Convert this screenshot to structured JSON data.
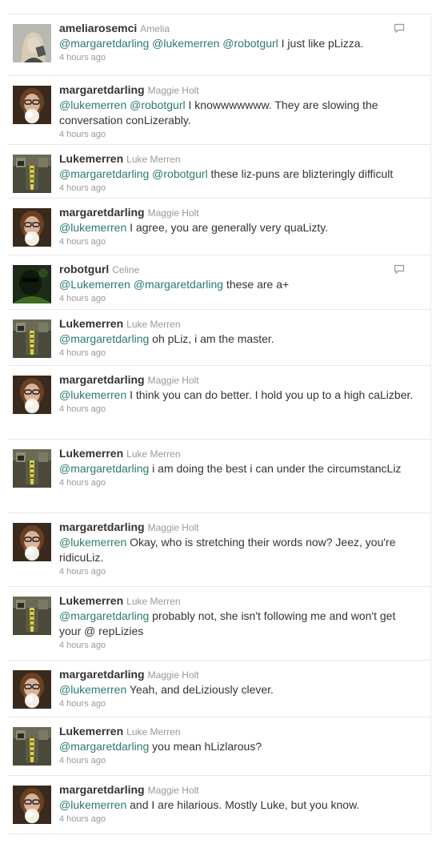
{
  "tweets": [
    {
      "avatar": "blonde-woman",
      "username": "ameliarosemci",
      "realname": "Amelia",
      "mentions": [
        "@margaretdarling",
        "@lukemerren",
        "@robotgurl"
      ],
      "text": " I just like pLizza.",
      "time": "4 hours ago",
      "reply_icon": true
    },
    {
      "avatar": "bearded-man",
      "username": "margaretdarling",
      "realname": "Maggie Holt",
      "mentions": [
        "@lukemerren",
        "@robotgurl"
      ],
      "text": " I knowwwwwww. They are slowing the conversation conLizerably.",
      "time": "4 hours ago",
      "reply_icon": false
    },
    {
      "avatar": "robot-tie",
      "username": "Lukemerren",
      "realname": "Luke Merren",
      "mentions": [
        "@margaretdarling",
        "@robotgurl"
      ],
      "text": " these liz-puns are blizteringly difficult",
      "time": "4 hours ago",
      "reply_icon": false
    },
    {
      "avatar": "bearded-man",
      "username": "margaretdarling",
      "realname": "Maggie Holt",
      "mentions": [
        "@lukemerren"
      ],
      "text": " I agree, you are generally very quaLizty.",
      "time": "4 hours ago",
      "reply_icon": false
    },
    {
      "avatar": "dark-green",
      "username": "robotgurl",
      "realname": "Celine",
      "mentions": [
        "@Lukemerren",
        "@margaretdarling"
      ],
      "text": " these are a+",
      "time": "4 hours ago",
      "reply_icon": true
    },
    {
      "avatar": "robot-tie",
      "username": "Lukemerren",
      "realname": "Luke Merren",
      "mentions": [
        "@margaretdarling"
      ],
      "text": " oh pLiz, i am the master.",
      "time": "4 hours ago",
      "reply_icon": false
    },
    {
      "avatar": "bearded-man",
      "username": "margaretdarling",
      "realname": "Maggie Holt",
      "mentions": [
        "@lukemerren"
      ],
      "text": " I think you can do better. I hold you up to a high caLizber.",
      "time": "4 hours ago",
      "reply_icon": false
    },
    {
      "avatar": "robot-tie",
      "username": "Lukemerren",
      "realname": "Luke Merren",
      "mentions": [
        "@margaretdarling"
      ],
      "text": " i am doing the best i can under the circumstancLiz",
      "time": "4 hours ago",
      "reply_icon": false
    },
    {
      "avatar": "bearded-man",
      "username": "margaretdarling",
      "realname": "Maggie Holt",
      "mentions": [
        "@lukemerren"
      ],
      "text": " Okay, who is stretching their words now? Jeez, you're ridicuLiz.",
      "time": "4 hours ago",
      "reply_icon": false
    },
    {
      "avatar": "robot-tie",
      "username": "Lukemerren",
      "realname": "Luke Merren",
      "mentions": [
        "@margaretdarling"
      ],
      "text": " probably not, she isn't following me and won't get your @ repLizies",
      "time": "4 hours ago",
      "reply_icon": false
    },
    {
      "avatar": "bearded-man",
      "username": "margaretdarling",
      "realname": "Maggie Holt",
      "mentions": [
        "@lukemerren"
      ],
      "text": " Yeah, and deLiziously clever.",
      "time": "4 hours ago",
      "reply_icon": false
    },
    {
      "avatar": "robot-tie",
      "username": "Lukemerren",
      "realname": "Luke Merren",
      "mentions": [
        "@margaretdarling"
      ],
      "text": " you mean hLizlarous?",
      "time": "4 hours ago",
      "reply_icon": false
    },
    {
      "avatar": "bearded-man",
      "username": "margaretdarling",
      "realname": "Maggie Holt",
      "mentions": [
        "@lukemerren"
      ],
      "text": " and I are hilarious. Mostly Luke, but you know.",
      "time": "4 hours ago",
      "reply_icon": false
    }
  ],
  "colors": {
    "mention": "#2a7a6f",
    "username": "#333333",
    "meta": "#999999",
    "divider": "#e8e8e8"
  }
}
